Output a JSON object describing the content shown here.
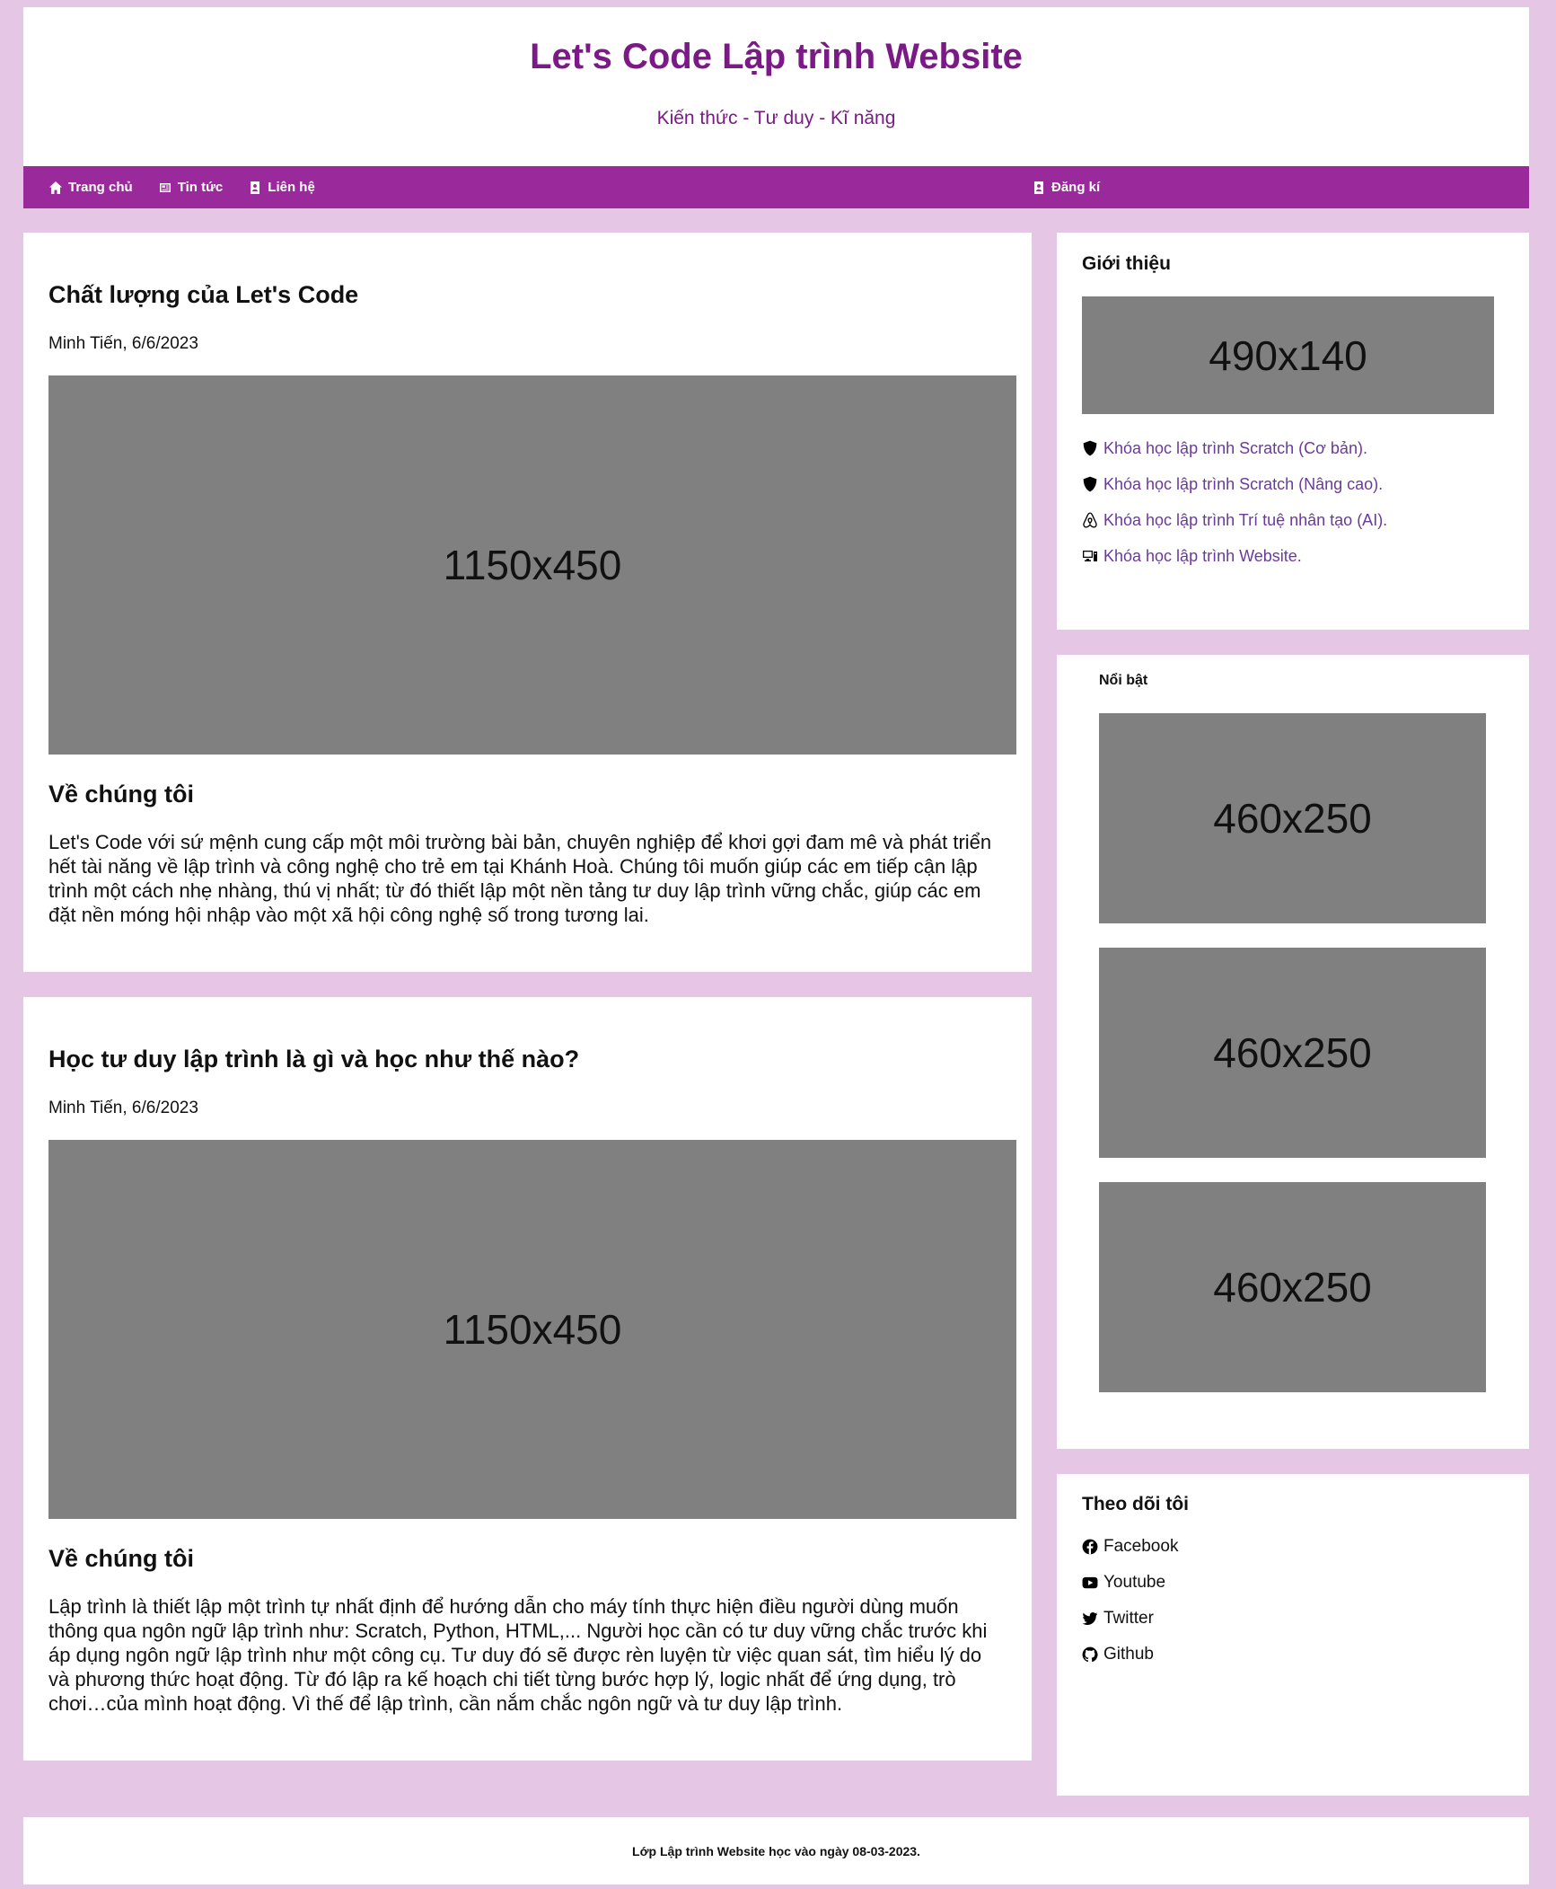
{
  "header": {
    "title": "Let's Code Lập trình Website",
    "subtitle": "Kiến thức - Tư duy - Kĩ năng"
  },
  "nav": {
    "items": [
      {
        "label": "Trang chủ",
        "icon": "home-icon"
      },
      {
        "label": "Tin tức",
        "icon": "newspaper-icon"
      },
      {
        "label": "Liên hệ",
        "icon": "contact-icon"
      }
    ],
    "right": {
      "label": "Đăng kí",
      "icon": "contact-icon"
    }
  },
  "posts": [
    {
      "title": "Chất lượng của Let's Code",
      "meta": "Minh Tiến, 6/6/2023",
      "image_label": "1150x450",
      "section_title": "Về chúng tôi",
      "body": "Let's Code với sứ mệnh cung cấp một môi trường bài bản, chuyên nghiệp để khơi gợi đam mê và phát triển hết tài năng về lập trình và công nghệ cho trẻ em tại Khánh Hoà. Chúng tôi muốn giúp các em tiếp cận lập trình một cách nhẹ nhàng, thú vị nhất; từ đó thiết lập một nền tảng tư duy lập trình vững chắc, giúp các em đặt nền móng hội nhập vào một xã hội công nghệ số trong tương lai."
    },
    {
      "title": "Học tư duy lập trình là gì và học như thế nào?",
      "meta": "Minh Tiến, 6/6/2023",
      "image_label": "1150x450",
      "section_title": "Về chúng tôi",
      "body": "Lập trình là thiết lập một trình tự nhất định để hướng dẫn cho máy tính thực hiện điều người dùng muốn thông qua ngôn ngữ lập trình như: Scratch, Python, HTML,... Người học cần có tư duy vững chắc trước khi áp dụng ngôn ngữ lập trình như một công cụ. Tư duy đó sẽ được rèn luyện từ việc quan sát, tìm hiểu lý do và phương thức hoạt động. Từ đó lập ra kế hoạch chi tiết từng bước hợp lý, logic nhất để ứng dụng, trò chơi…của mình hoạt động. Vì thế để lập trình, cần nắm chắc ngôn ngữ và tư duy lập trình."
    }
  ],
  "sidebar": {
    "intro": {
      "title": "Giới thiệu",
      "image_label": "490x140",
      "courses": [
        {
          "label": "Khóa học lập trình Scratch (Cơ bản).",
          "icon": "shield-icon"
        },
        {
          "label": "Khóa học lập trình Scratch (Nâng cao).",
          "icon": "shield-icon"
        },
        {
          "label": "Khóa học lập trình Trí tuệ nhân tạo (AI).",
          "icon": "airbnb-icon"
        },
        {
          "label": "Khóa học lập trình Website.",
          "icon": "computer-icon"
        }
      ]
    },
    "featured": {
      "title": "Nổi bật",
      "images": [
        "460x250",
        "460x250",
        "460x250"
      ]
    },
    "follow": {
      "title": "Theo dõi tôi",
      "links": [
        {
          "label": "Facebook",
          "icon": "facebook-icon"
        },
        {
          "label": "Youtube",
          "icon": "youtube-icon"
        },
        {
          "label": "Twitter",
          "icon": "twitter-icon"
        },
        {
          "label": "Github",
          "icon": "github-icon"
        }
      ]
    }
  },
  "footer": {
    "text": "Lớp Lập trình Website học vào ngày 08-03-2023."
  },
  "colors": {
    "background": "#e5c6e5",
    "nav": "#9a2a9c",
    "title": "#7b1a86",
    "placeholder": "#808080"
  }
}
